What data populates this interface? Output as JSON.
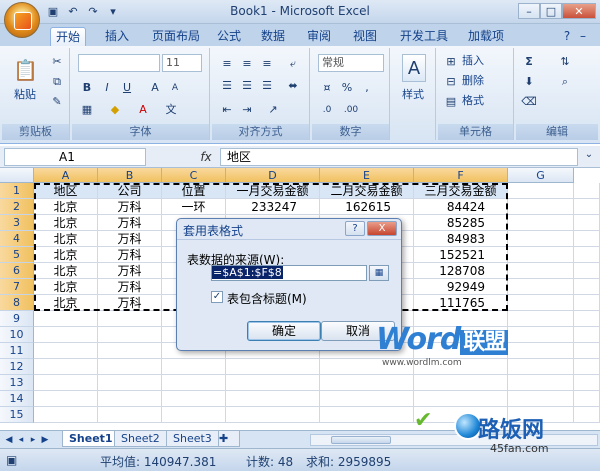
{
  "window": {
    "title": "Book1 - Microsoft Excel"
  },
  "tabs": [
    "开始",
    "插入",
    "页面布局",
    "公式",
    "数据",
    "审阅",
    "视图",
    "开发工具",
    "加载项"
  ],
  "ribbon": {
    "clipboard": {
      "label": "剪贴板",
      "paste": "粘贴"
    },
    "font": {
      "label": "字体",
      "size": "11"
    },
    "alignment": {
      "label": "对齐方式"
    },
    "number": {
      "label": "数字",
      "format": "常规"
    },
    "styles": {
      "label": "样式"
    },
    "cells": {
      "label": "单元格",
      "insert": "插入",
      "delete": "删除",
      "format": "格式"
    },
    "editing": {
      "label": "编辑"
    }
  },
  "formula_bar": {
    "name_box": "A1",
    "fx": "fx",
    "content": "地区"
  },
  "columns": [
    "A",
    "B",
    "C",
    "D",
    "E",
    "F",
    "G"
  ],
  "rows": [
    "1",
    "2",
    "3",
    "4",
    "5",
    "6",
    "7",
    "8",
    "9",
    "10",
    "11",
    "12",
    "13",
    "14",
    "15"
  ],
  "table": {
    "headers": [
      "地区",
      "公司",
      "位置",
      "一月交易金额",
      "二月交易金额",
      "三月交易金额"
    ],
    "rows": [
      [
        "北京",
        "万科",
        "一环",
        "233247",
        "162615",
        "84424"
      ],
      [
        "北京",
        "万科",
        "",
        "",
        "",
        "85285"
      ],
      [
        "北京",
        "万科",
        "",
        "",
        "",
        "84983"
      ],
      [
        "北京",
        "万科",
        "",
        "",
        "",
        "152521"
      ],
      [
        "北京",
        "万科",
        "",
        "",
        "",
        "128708"
      ],
      [
        "北京",
        "万科",
        "",
        "",
        "",
        "92949"
      ],
      [
        "北京",
        "万科",
        "",
        "",
        "",
        "111765"
      ]
    ]
  },
  "dialog": {
    "title": "套用表格式",
    "help": "?",
    "close": "X",
    "source_label": "表数据的来源(W):",
    "source_value": "=$A$1:$F$8",
    "checkbox_label": "表包含标题(M)",
    "checkbox_checked": true,
    "ok": "确定",
    "cancel": "取消"
  },
  "sheets": [
    "Sheet1",
    "Sheet2",
    "Sheet3"
  ],
  "status": {
    "average": "平均值: 140947.381",
    "count": "计数: 48",
    "sum": "求和: 2959895"
  },
  "watermarks": {
    "word": "Word",
    "union": "联盟",
    "site": "www.wordlm.com",
    "brand": "路饭网",
    "brand_url": "45fan.com"
  },
  "colors": {
    "ribbon_blue": "#c4d6ec",
    "header_fill": "#d9e6f5",
    "selected_header": "#f1c15f",
    "accent": "#15428b"
  }
}
